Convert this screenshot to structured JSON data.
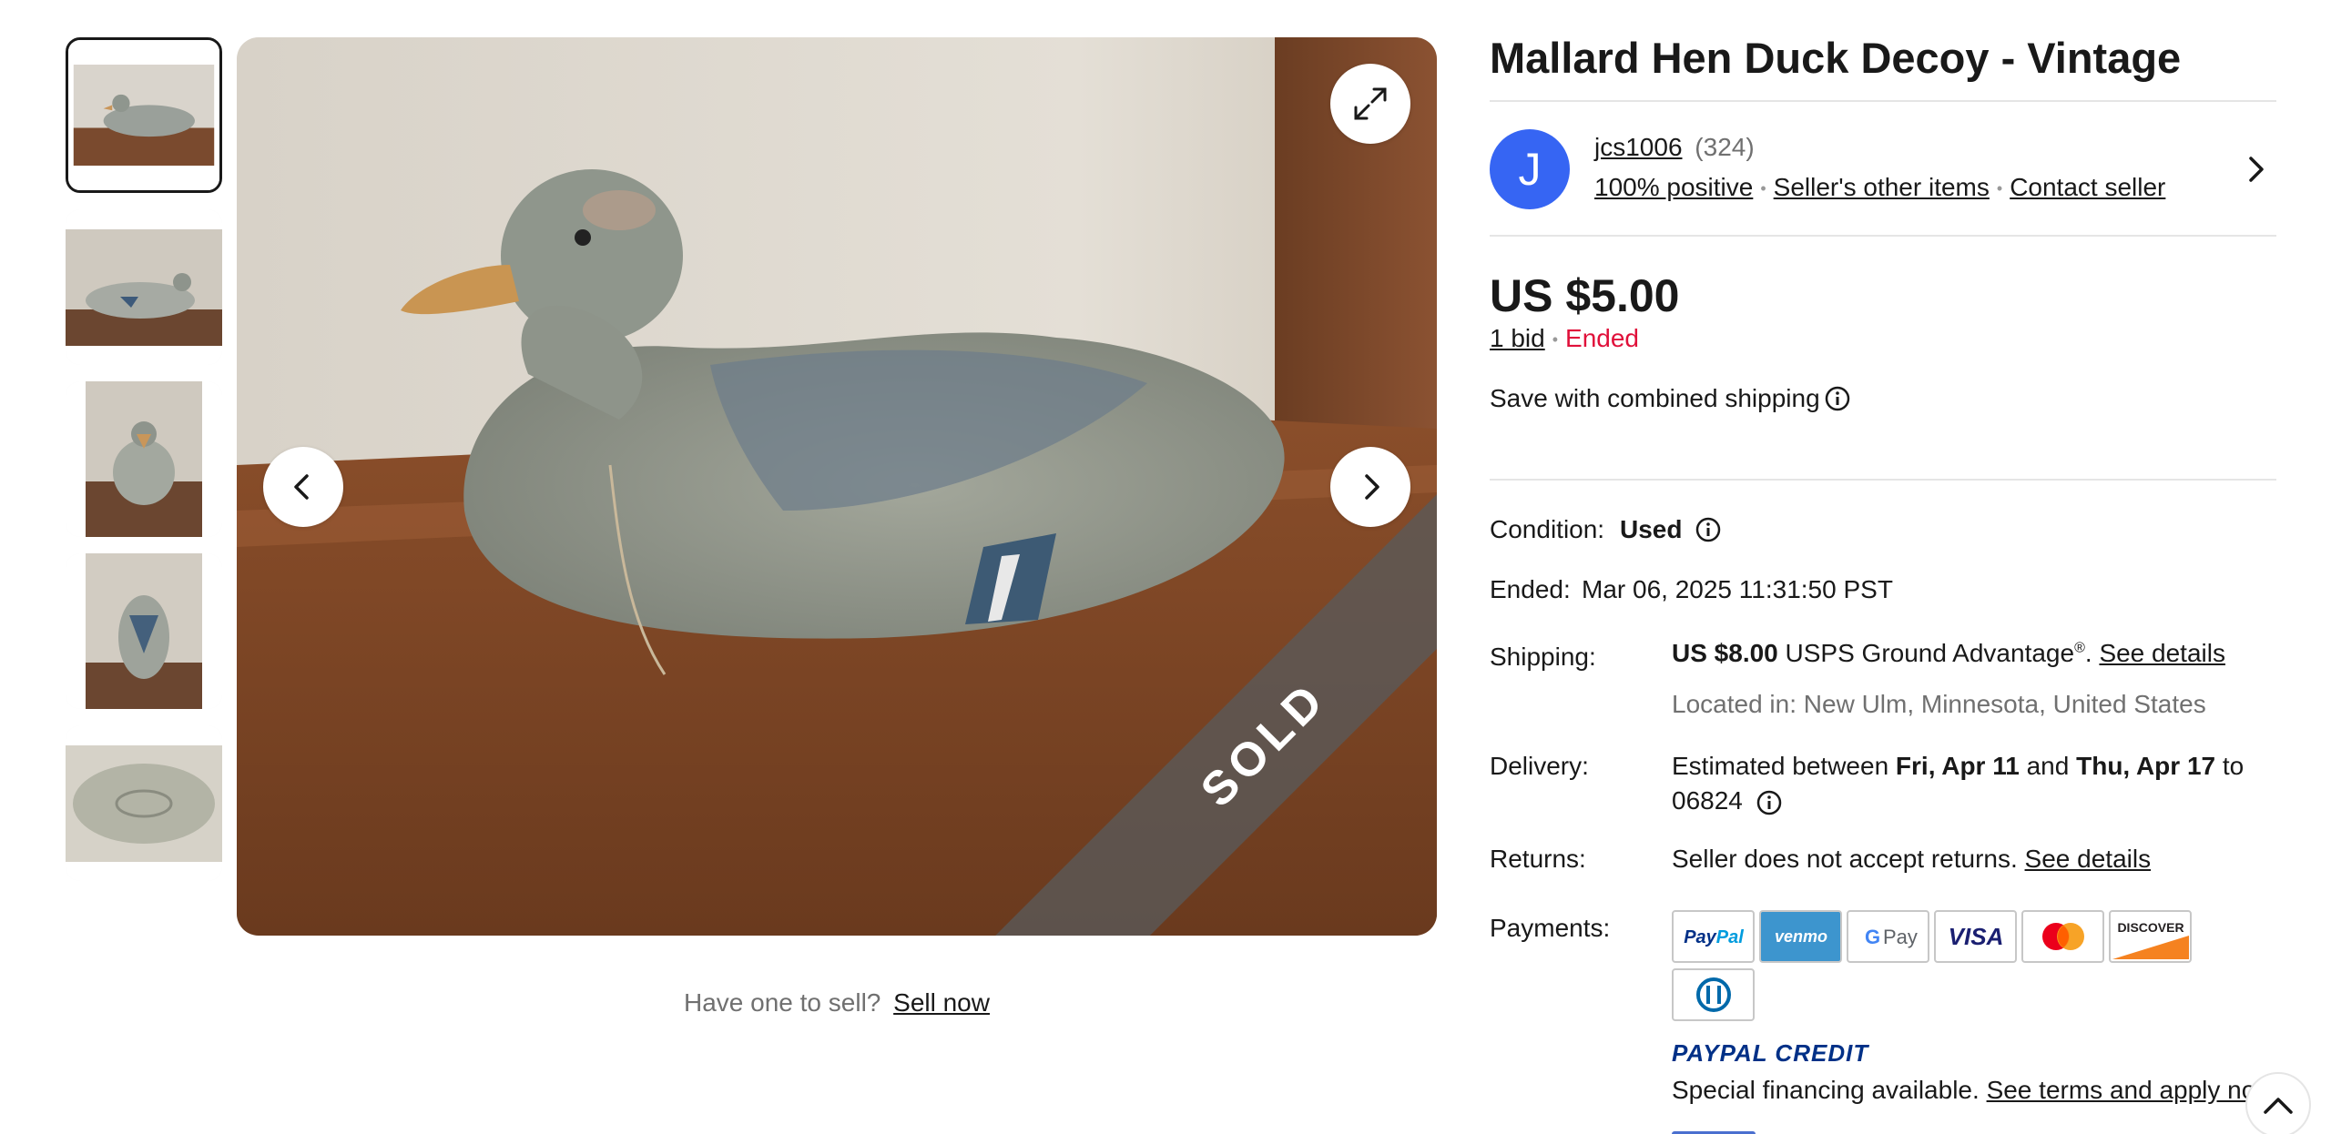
{
  "listing": {
    "title": "Mallard Hen Duck Decoy - Vintage",
    "sold_badge": "SOLD"
  },
  "seller": {
    "avatar_letter": "J",
    "name": "jcs1006",
    "feedback_count": "(324)",
    "positive": "100% positive",
    "other_items": "Seller's other items",
    "contact": "Contact seller"
  },
  "price": {
    "amount": "US $5.00",
    "bids": "1 bid",
    "status": "Ended",
    "combined_shipping": "Save with combined shipping"
  },
  "details": {
    "condition_label": "Condition:",
    "condition_value": "Used",
    "ended_label": "Ended:",
    "ended_value": "Mar 06, 2025 11:31:50 PST",
    "shipping_label": "Shipping:",
    "shipping_cost": "US $8.00",
    "shipping_service": "USPS Ground Advantage",
    "shipping_reg": "®",
    "shipping_period": ".",
    "shipping_details_link": "See details",
    "located_in": "Located in: New Ulm, Minnesota, United States",
    "delivery_label": "Delivery:",
    "delivery_prefix": "Estimated between",
    "delivery_start": "Fri, Apr 11",
    "delivery_and": "and",
    "delivery_end": "Thu, Apr 17",
    "delivery_to": "to",
    "delivery_zip": "06824",
    "returns_label": "Returns:",
    "returns_text": "Seller does not accept returns.",
    "returns_link": "See details",
    "payments_label": "Payments:",
    "paypal_credit": "PAYPAL CREDIT",
    "financing_text": "Special financing available.",
    "financing_link": "See terms and apply now"
  },
  "payment_methods": [
    "PayPal",
    "venmo",
    "G Pay",
    "VISA",
    "mastercard",
    "DISCOVER",
    "Diners Club"
  ],
  "sell": {
    "prompt": "Have one to sell?",
    "link": "Sell now"
  },
  "icons": {
    "expand": "expand-icon",
    "prev": "chevron-left-icon",
    "next": "chevron-right-icon",
    "info": "info-icon",
    "back_to_top": "chevron-up-icon"
  },
  "colors": {
    "ended": "#e0103a",
    "avatar": "#3665f3",
    "text": "#191919",
    "muted": "#707070"
  }
}
